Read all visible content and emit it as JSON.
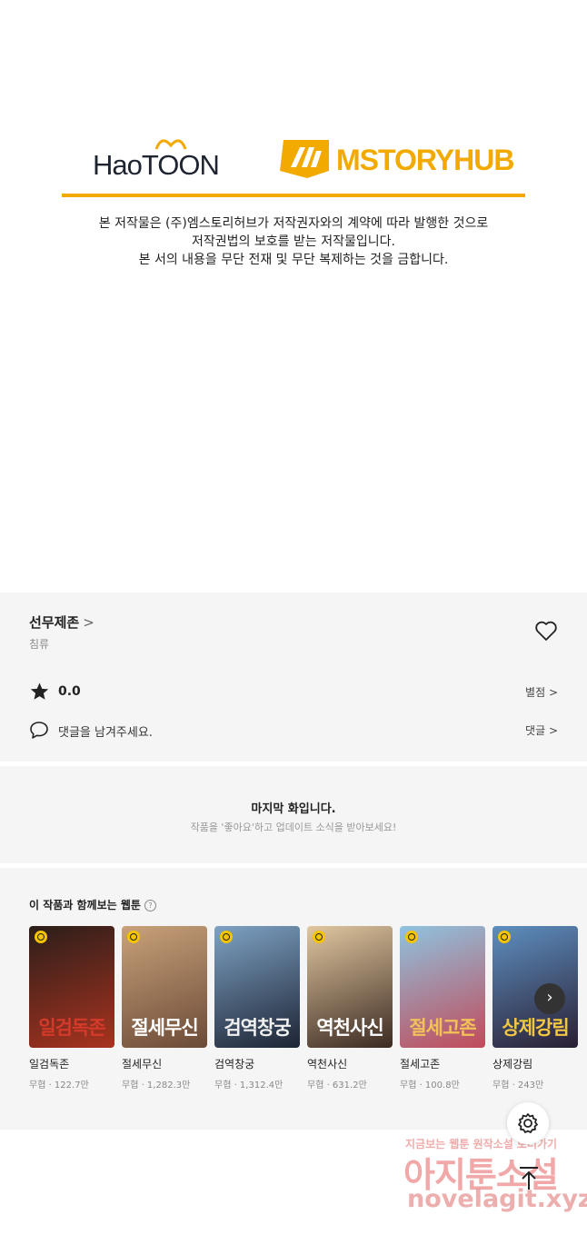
{
  "publishers": {
    "haotoon_logo_text": "HaoTOON",
    "mstoryhub_logo_text": "MSTORYHUB",
    "brand_gold": "#f2a900"
  },
  "notice_lines": [
    "본 저작물은 (주)엠스토리허브가 저작권자와의 계약에 따라 발행한 것으로",
    "저작권법의 보호를 받는 저작물입니다.",
    "본 서의 내용을 무단 전재 및 무단 복제하는 것을 금합니다."
  ],
  "work": {
    "title": "선무제존",
    "title_chevron": ">",
    "author": "침류",
    "rating": "0.0",
    "rate_link": "별점 >",
    "comment_prompt": "댓글을 남겨주세요.",
    "comment_link": "댓글 >"
  },
  "last_episode": {
    "title": "마지막 화입니다.",
    "subtitle": "작품을 '좋아요'하고 업데이트 소식을 받아보세요!"
  },
  "recommendations": {
    "heading": "이 작품과 함께보는 웹툰",
    "help_icon": "?",
    "next_icon": "›",
    "items": [
      {
        "title": "일검독존",
        "meta": "무협 · 122.7만",
        "logo": "일검독존",
        "logo_color": "#d43a2a",
        "colors": [
          "#2b1e1a",
          "#a8331f"
        ]
      },
      {
        "title": "절세무신",
        "meta": "무협 · 1,282.3만",
        "logo": "절세무신",
        "logo_color": "#ffffff",
        "colors": [
          "#c9a27a",
          "#6b4a37"
        ]
      },
      {
        "title": "검역창궁",
        "meta": "무협 · 1,312.4만",
        "logo": "검역창궁",
        "logo_color": "#f0f0f0",
        "colors": [
          "#7ea2c4",
          "#1d2434"
        ]
      },
      {
        "title": "역천사신",
        "meta": "무협 · 631.2만",
        "logo": "역천사신",
        "logo_color": "#ffffff",
        "colors": [
          "#e0c7a0",
          "#3c2a22"
        ]
      },
      {
        "title": "절세고존",
        "meta": "무협 · 100.8만",
        "logo": "절세고존",
        "logo_color": "#f2c15a",
        "colors": [
          "#8fc3df",
          "#c04b5a"
        ]
      },
      {
        "title": "상제강림",
        "meta": "무협 · 243만",
        "logo": "상제강림",
        "logo_color": "#f3c640",
        "colors": [
          "#5d8fc0",
          "#2a1f33"
        ]
      }
    ]
  },
  "watermark": {
    "line1": "지금보는 웹툰 원작소설 보러가기",
    "line2": "아지툰소설",
    "line3": "novelagit.xyz"
  }
}
